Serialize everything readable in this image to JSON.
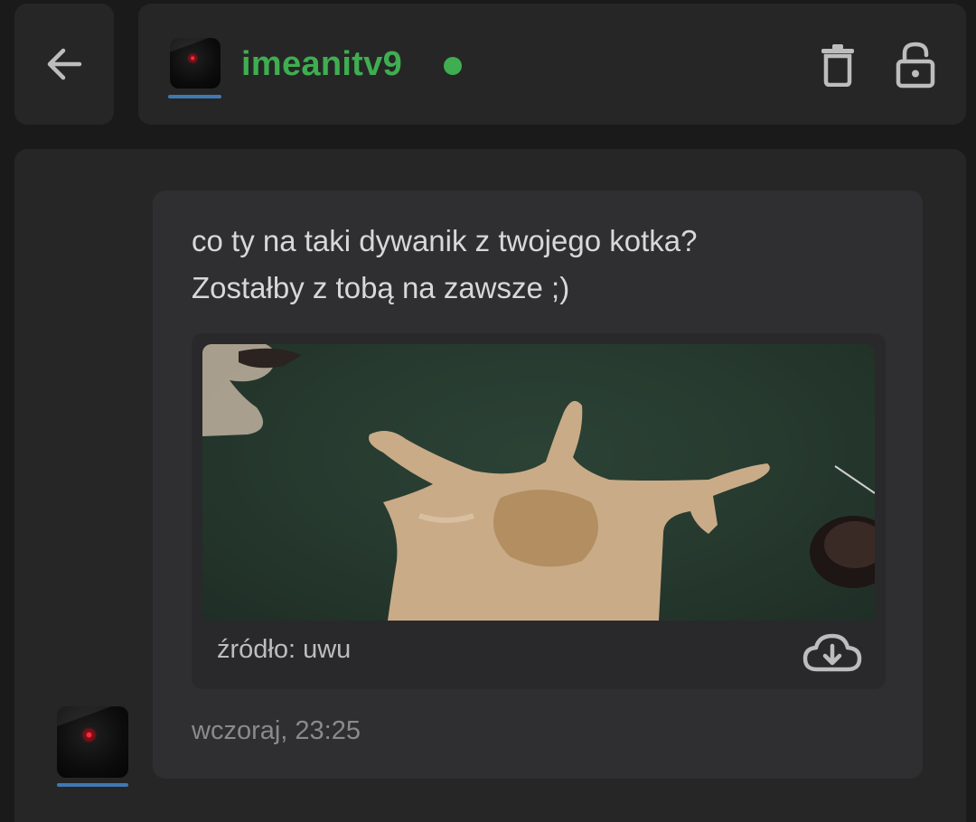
{
  "header": {
    "username": "imeanitv9",
    "online": true,
    "colors": {
      "username": "#3fae50",
      "online_dot": "#3fae50",
      "avatar_underline": "#3f79b2"
    },
    "icons": [
      "back-arrow-icon",
      "trash-icon",
      "unlock-icon"
    ]
  },
  "message": {
    "text": "co ty na taki dywanik z twojego kotka?\nZostałby z tobą na zawsze ;)",
    "attachment": {
      "source_label": "źródło: uwu",
      "download_icon": "cloud-download-icon"
    },
    "timestamp": "wczoraj, 23:25"
  }
}
